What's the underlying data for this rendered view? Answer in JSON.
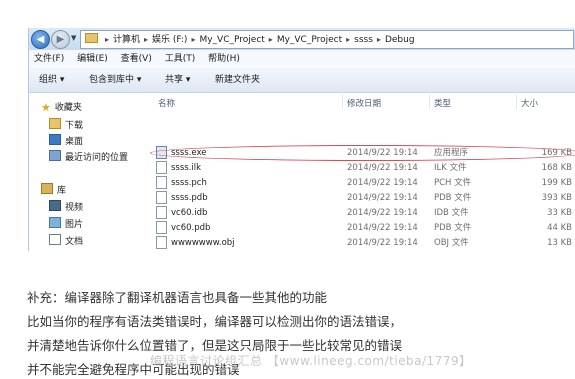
{
  "address_bar": {
    "crumbs": [
      "计算机",
      "娱乐 (F:)",
      "My_VC_Project",
      "My_VC_Project",
      "ssss",
      "Debug"
    ]
  },
  "menu": [
    "文件(F)",
    "编辑(E)",
    "查看(V)",
    "工具(T)",
    "帮助(H)"
  ],
  "toolbar": {
    "organize": "组织 ▾",
    "include_library": "包含到库中 ▾",
    "share": "共享 ▾",
    "new_folder": "新建文件夹"
  },
  "nav_pane": {
    "favorites": "收藏夹",
    "download": "下载",
    "desktop": "桌面",
    "recent": "最近访问的位置",
    "library": "库",
    "video": "视频",
    "pictures": "图片",
    "documents": "文档"
  },
  "columns": {
    "name": "名称",
    "date": "修改日期",
    "type": "类型",
    "size": "大小"
  },
  "files": [
    {
      "name": "ssss.exe",
      "date": "2014/9/22 19:14",
      "type": "应用程序",
      "size": "169 KB"
    },
    {
      "name": "ssss.ilk",
      "date": "2014/9/22 19:14",
      "type": "ILK 文件",
      "size": "168 KB"
    },
    {
      "name": "ssss.pch",
      "date": "2014/9/22 19:14",
      "type": "PCH 文件",
      "size": "199 KB"
    },
    {
      "name": "ssss.pdb",
      "date": "2014/9/22 19:14",
      "type": "PDB 文件",
      "size": "393 KB"
    },
    {
      "name": "vc60.idb",
      "date": "2014/9/22 19:14",
      "type": "IDB 文件",
      "size": "33 KB"
    },
    {
      "name": "vc60.pdb",
      "date": "2014/9/22 19:14",
      "type": "PDB 文件",
      "size": "44 KB"
    },
    {
      "name": "wwwwwww.obj",
      "date": "2014/9/22 19:14",
      "type": "OBJ 文件",
      "size": "13 KB"
    }
  ],
  "paragraphs": [
    "补充：编译器除了翻译机器语言也具备一些其他的功能",
    "比如当你的程序有语法类错误时，编译器可以检测出你的语法错误，",
    "并清楚地告诉你什么位置错了，但是这只局限于一些比较常见的错误",
    "并不能完全避免程序中可能出现的错误"
  ],
  "watermark": "编程语言讨论组汇总 【www.lineeg.com/tieba/1779】"
}
